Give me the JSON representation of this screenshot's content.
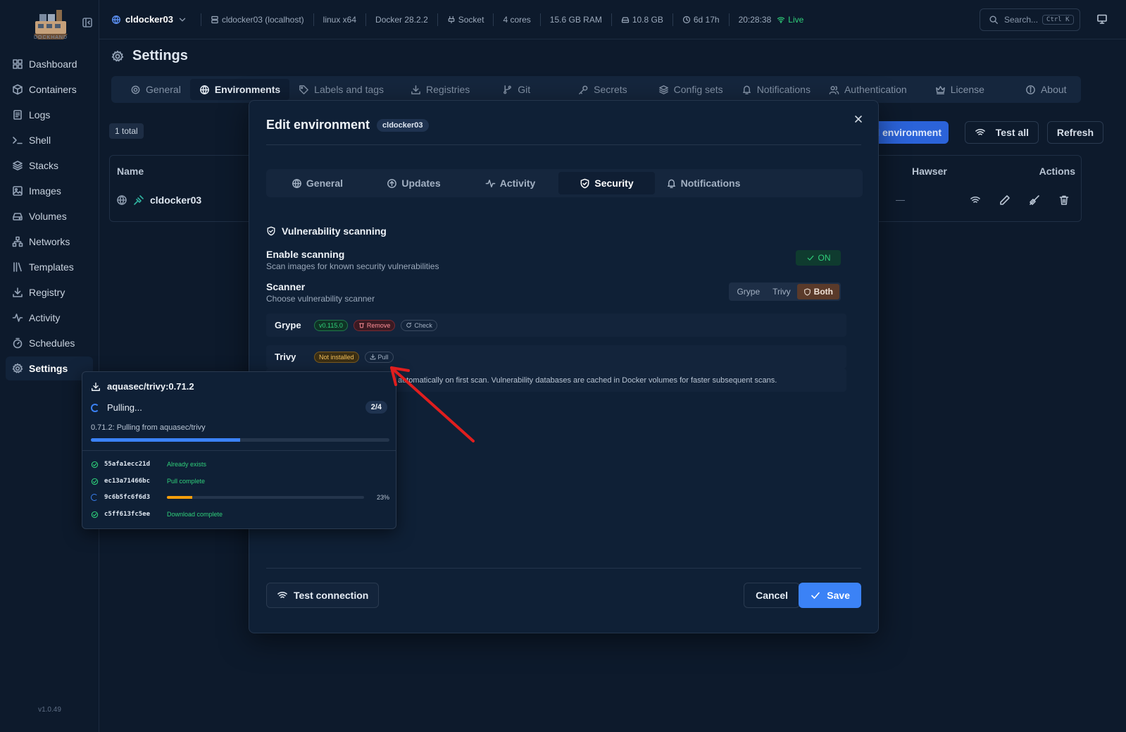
{
  "sidebar": {
    "logo_text": "DOCKHAND",
    "items": [
      {
        "label": "Dashboard",
        "icon": "grid-icon"
      },
      {
        "label": "Containers",
        "icon": "box-icon"
      },
      {
        "label": "Logs",
        "icon": "logs-icon"
      },
      {
        "label": "Shell",
        "icon": "terminal-icon"
      },
      {
        "label": "Stacks",
        "icon": "layers-icon"
      },
      {
        "label": "Images",
        "icon": "image-icon"
      },
      {
        "label": "Volumes",
        "icon": "drive-icon"
      },
      {
        "label": "Networks",
        "icon": "network-icon"
      },
      {
        "label": "Templates",
        "icon": "library-icon"
      },
      {
        "label": "Registry",
        "icon": "download-icon"
      },
      {
        "label": "Activity",
        "icon": "activity-icon"
      },
      {
        "label": "Schedules",
        "icon": "timer-icon"
      },
      {
        "label": "Settings",
        "icon": "gear-icon"
      }
    ],
    "active": "Settings",
    "version": "v1.0.49"
  },
  "topbar": {
    "env": "cldocker03",
    "host": "cldocker03 (localhost)",
    "platform": "linux x64",
    "docker": "Docker 28.2.2",
    "connection": "Socket",
    "cores": "4 cores",
    "ram": "15.6 GB RAM",
    "disk": "10.8 GB",
    "uptime": "6d 17h",
    "time": "20:28:38",
    "live": "Live",
    "search_placeholder": "Search...",
    "search_kbd": "Ctrl K"
  },
  "settings": {
    "title": "Settings",
    "tabs": [
      "General",
      "Environments",
      "Labels and tags",
      "Registries",
      "Git",
      "Secrets",
      "Config sets",
      "Notifications",
      "Authentication",
      "License",
      "About"
    ],
    "active_tab": "Environments",
    "total": "1 total",
    "add_environment": "Add environment",
    "test_all": "Test all",
    "refresh": "Refresh",
    "columns": {
      "name": "Name",
      "hawser": "Hawser",
      "actions": "Actions"
    },
    "row": {
      "name": "cldocker03",
      "hawser": "—"
    }
  },
  "modal": {
    "title": "Edit environment",
    "env_chip": "cldocker03",
    "tabs": [
      "General",
      "Updates",
      "Activity",
      "Security",
      "Notifications"
    ],
    "active_tab": "Security",
    "section_title": "Vulnerability scanning",
    "enable_label": "Enable scanning",
    "enable_desc": "Scan images for known security vulnerabilities",
    "enable_value": "ON",
    "scanner_label": "Scanner",
    "scanner_desc": "Choose vulnerability scanner",
    "scanner_options": [
      "Grype",
      "Trivy",
      "Both"
    ],
    "scanner_selected": "Both",
    "grype": {
      "name": "Grype",
      "version": "v0.115.0",
      "remove": "Remove",
      "check": "Check"
    },
    "trivy": {
      "name": "Trivy",
      "status": "Not installed",
      "pull": "Pull"
    },
    "info_text": "automatically on first scan. Vulnerability databases are cached in Docker volumes for faster subsequent scans.",
    "test_connection": "Test connection",
    "cancel": "Cancel",
    "save": "Save"
  },
  "pull": {
    "image": "aquasec/trivy:0.71.2",
    "status": "Pulling...",
    "count": "2/4",
    "message": "0.71.2: Pulling from aquasec/trivy",
    "progress": 0.5,
    "layers": [
      {
        "id": "55afa1ecc21d",
        "status": "Already exists",
        "done": true
      },
      {
        "id": "ec13a71466bc",
        "status": "Pull complete",
        "done": true
      },
      {
        "id": "9c6b5fc6f6d3",
        "status": "",
        "done": false,
        "progress": 0.13,
        "percent": "23%"
      },
      {
        "id": "c5ff613fc5ee",
        "status": "Download complete",
        "done": true
      }
    ]
  },
  "colors": {
    "accent": "#3b82f6",
    "success": "#2fcf7a",
    "warning": "#f59e0b",
    "danger": "#ff8f98",
    "annotation_arrow": "#e01e1e"
  }
}
